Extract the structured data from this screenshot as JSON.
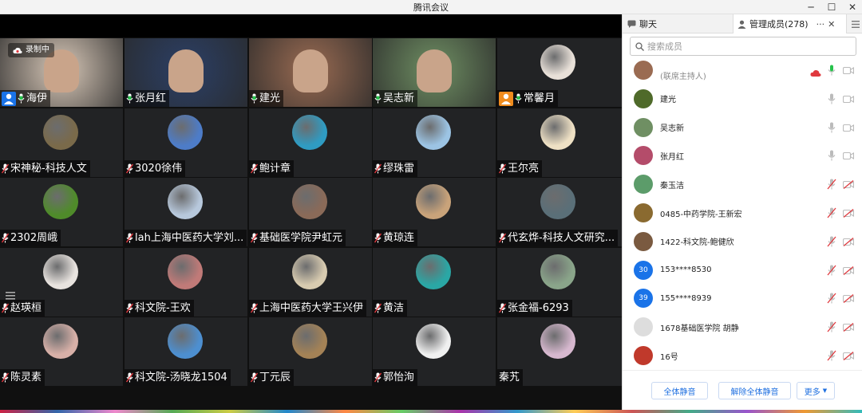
{
  "window": {
    "title": "腾讯会议"
  },
  "recording": {
    "label": "录制中"
  },
  "tiles": [
    {
      "name": "海伊",
      "kind": "video",
      "host_badge": true,
      "mic": "on",
      "color": "#d9c9b9"
    },
    {
      "name": "张月红",
      "kind": "video",
      "mic": "on",
      "color": "#2b3f66"
    },
    {
      "name": "建光",
      "kind": "video",
      "mic": "on",
      "color": "#9a6b52"
    },
    {
      "name": "吴志新",
      "kind": "video",
      "mic": "on",
      "color": "#6f8f63"
    },
    {
      "name": "常馨月",
      "kind": "avatar",
      "host_badge": true,
      "mic": "on",
      "color": "#e8e0d8"
    },
    {
      "name": "宋神秘-科技人文",
      "kind": "avatar",
      "mic": "off",
      "color": "#7a6a4a"
    },
    {
      "name": "3020徐伟",
      "kind": "avatar",
      "mic": "off",
      "color": "#4d7cc8"
    },
    {
      "name": "鲍计章",
      "kind": "avatar",
      "mic": "off",
      "color": "#2f9bc2"
    },
    {
      "name": "缪珠雷",
      "kind": "avatar",
      "mic": "off",
      "color": "#9cc4e4"
    },
    {
      "name": "王尔亮",
      "kind": "avatar",
      "mic": "off",
      "color": "#eee0c4"
    },
    {
      "name": "2302周峨",
      "kind": "avatar",
      "mic": "off",
      "color": "#4f8b2a"
    },
    {
      "name": "lah上海中医药大学刘...",
      "kind": "avatar",
      "mic": "off",
      "color": "#b7c8dc"
    },
    {
      "name": "基础医学院尹虹元",
      "kind": "avatar",
      "mic": "off",
      "color": "#8a6a58"
    },
    {
      "name": "黄琼连",
      "kind": "avatar",
      "mic": "off",
      "color": "#c9a37a"
    },
    {
      "name": "代玄烨-科技人文研究...",
      "kind": "avatar",
      "mic": "off",
      "color": "#5a6f78"
    },
    {
      "name": "赵瑛桓",
      "kind": "avatar",
      "mic": "off",
      "color": "#e8e3df"
    },
    {
      "name": "科文院-王欢",
      "kind": "avatar",
      "mic": "off",
      "color": "#c07a78"
    },
    {
      "name": "上海中医药大学王兴伊",
      "kind": "avatar",
      "mic": "off",
      "color": "#d8cbb0"
    },
    {
      "name": "黄洁",
      "kind": "avatar",
      "mic": "off",
      "color": "#2aa7a5"
    },
    {
      "name": "张金福-6293",
      "kind": "avatar",
      "mic": "off",
      "color": "#8aa58a"
    },
    {
      "name": "陈灵素",
      "kind": "avatar",
      "mic": "off",
      "color": "#d8b0a8"
    },
    {
      "name": "科文院-汤晓龙1504",
      "kind": "avatar",
      "mic": "off",
      "color": "#4d8fd0"
    },
    {
      "name": "丁元辰",
      "kind": "avatar",
      "mic": "off",
      "color": "#a48256"
    },
    {
      "name": "郭怡洵",
      "kind": "avatar",
      "mic": "off",
      "color": "#f0f0f0"
    },
    {
      "name": "秦艽",
      "kind": "avatar",
      "mic": "none",
      "color": "#d7b8cf"
    }
  ],
  "panel": {
    "chat_tab": "聊天",
    "members_tab": "管理成员(278)",
    "search_placeholder": "搜索成员",
    "members": [
      {
        "name": "",
        "sub": "(联席主持人)",
        "color": "#9a6b52",
        "mic": "on",
        "cam": "on",
        "cloud": true
      },
      {
        "name": "建光",
        "color": "#4f6a2a",
        "mic": "on-gray",
        "cam": "on"
      },
      {
        "name": "吴志新",
        "color": "#6f8f63",
        "mic": "on-gray",
        "cam": "on"
      },
      {
        "name": "张月红",
        "color": "#b44c6a",
        "mic": "on-gray",
        "cam": "on"
      },
      {
        "name": "秦玉洁",
        "color": "#5c9c6a",
        "mic": "off",
        "cam": "off"
      },
      {
        "name": "0485-中药学院-王新宏",
        "color": "#8a6a30",
        "mic": "off",
        "cam": "off"
      },
      {
        "name": "1422-科文院-鲍健欣",
        "color": "#7a5a40",
        "mic": "off",
        "cam": "off"
      },
      {
        "name": "153****8530",
        "initial": "30",
        "color": "#1a73e8",
        "mic": "off",
        "cam": "off"
      },
      {
        "name": "155****8939",
        "initial": "39",
        "color": "#1a73e8",
        "mic": "off",
        "cam": "off"
      },
      {
        "name": "1678基础医学院 胡静",
        "color": "#dddddd",
        "mic": "off",
        "cam": "off"
      },
      {
        "name": "16号",
        "color": "#c0392b",
        "mic": "off",
        "cam": "off"
      }
    ],
    "footer": {
      "mute_all": "全体静音",
      "unmute_all": "解除全体静音",
      "more": "更多"
    }
  },
  "colors": {
    "accent": "#1e6fe0",
    "stage": "#101010",
    "tile": "#222325",
    "mic_on": "#27c24c",
    "mic_off": "#e0393e"
  }
}
